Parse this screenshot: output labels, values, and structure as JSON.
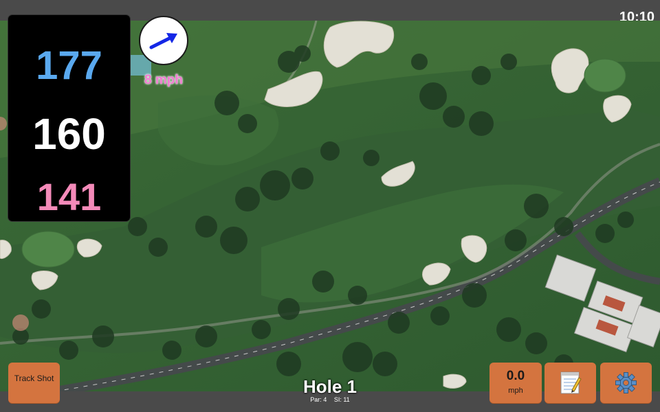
{
  "status": {
    "time": "10:10"
  },
  "yardage": {
    "back": "177",
    "center": "160",
    "front": "141"
  },
  "wind": {
    "speed": "8 mph",
    "arrow_icon": "arrow-icon"
  },
  "buttons": {
    "track_shot": "Track Shot",
    "speed_value": "0.0",
    "speed_unit": "mph",
    "notes_icon": "notepad-icon",
    "settings_icon": "gear-icon"
  },
  "hole": {
    "title": "Hole 1",
    "par": "Par: 4",
    "si": "SI: 11"
  },
  "colors": {
    "back": "#5aa9ef",
    "center": "#ffffff",
    "front": "#f48ab9",
    "wind_speed": "#f07bd0",
    "button": "#d4743f",
    "fairway": "#2f5a30",
    "rough": "#3d6b3a"
  }
}
